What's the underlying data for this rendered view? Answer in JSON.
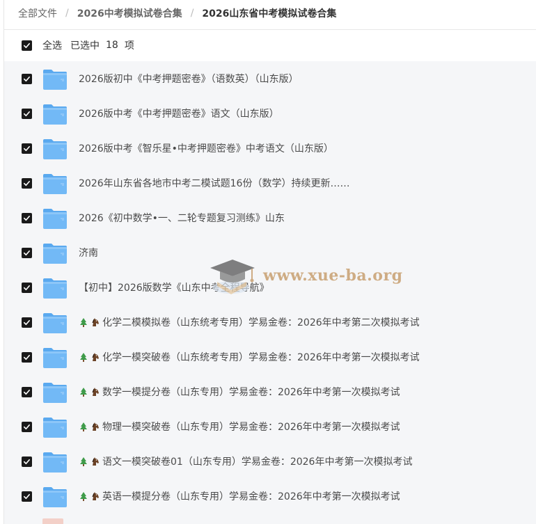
{
  "breadcrumb": {
    "root": "全部文件",
    "parent": "2026中考模拟试卷合集",
    "current": "2026山东省中考模拟试卷合集",
    "separator": "/"
  },
  "selection": {
    "select_all_label": "全选",
    "selected_prefix": "已选中",
    "selected_count": "18",
    "selected_suffix": "项"
  },
  "folders": [
    {
      "name": "2026版初中《中考押题密卷》（语数英）（山东版）",
      "prefix_icons": false
    },
    {
      "name": "2026版中考《中考押题密卷》语文（山东版）",
      "prefix_icons": false
    },
    {
      "name": "2026版中考《智乐星•中考押题密卷》中考语文（山东版）",
      "prefix_icons": false
    },
    {
      "name": "2026年山东省各地市中考二模试题16份（数学）持续更新……",
      "prefix_icons": false
    },
    {
      "name": "2026《初中数学•一、二轮专题复习测练》山东",
      "prefix_icons": false
    },
    {
      "name": "济南",
      "prefix_icons": false
    },
    {
      "name": "【初中】2026版数学《山东中考全程导航》",
      "prefix_icons": false
    },
    {
      "name": "化学二模模拟卷（山东统考专用）学易金卷：2026年中考第二次模拟考试",
      "prefix_icons": true
    },
    {
      "name": "化学一模突破卷（山东统考专用）学易金卷：2026年中考第一次模拟考试",
      "prefix_icons": true
    },
    {
      "name": "数学一模提分卷（山东专用）学易金卷：2026年中考第一次模拟考试",
      "prefix_icons": true
    },
    {
      "name": "物理一模突破卷（山东专用）学易金卷：2026年中考第一次模拟考试",
      "prefix_icons": true
    },
    {
      "name": "语文一模突破卷01（山东专用）学易金卷：2026年中考第一次模拟考试",
      "prefix_icons": true
    },
    {
      "name": "英语一模提分卷（山东专用）学易金卷：2026年中考第一次模拟考试",
      "prefix_icons": true
    }
  ],
  "watermark": {
    "text": "www.xue-ba.org"
  },
  "icons": {
    "checkbox": "checked-checkbox-icon",
    "folder": "folder-icon",
    "tree": "tree-emoji-icon",
    "horse": "horse-emoji-icon"
  },
  "colors": {
    "folder": "#6cb6f5",
    "checkbox": "#1a1a1a",
    "list_bg": "#f5f6f8",
    "watermark": "#c8a070"
  }
}
